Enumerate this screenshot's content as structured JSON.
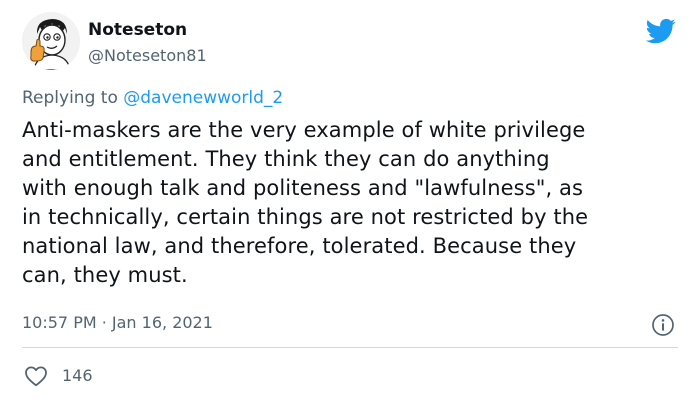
{
  "tweet": {
    "author": {
      "display_name": "Noteseton",
      "handle": "@Noteseton81"
    },
    "reply": {
      "prefix": "Replying to",
      "mention": "@davenewworld_2"
    },
    "text_lines": [
      "Anti-maskers are the very example of white privilege",
      "and entitlement. They think they can do anything",
      "with enough talk and politeness and \"lawfulness\", as",
      "in technically, certain things are not restricted by the",
      "national law, and therefore, tolerated. Because they",
      "can, they must."
    ],
    "timestamp": "10:57 PM · Jan 16, 2021",
    "likes": "146"
  },
  "icons": {
    "brand": "twitter-bird-icon",
    "info": "info-icon",
    "like": "heart-icon"
  },
  "colors": {
    "brand_blue": "#1d9bf0",
    "text_primary": "#0f1419",
    "text_secondary": "#536471",
    "divider": "#cfd9de"
  }
}
